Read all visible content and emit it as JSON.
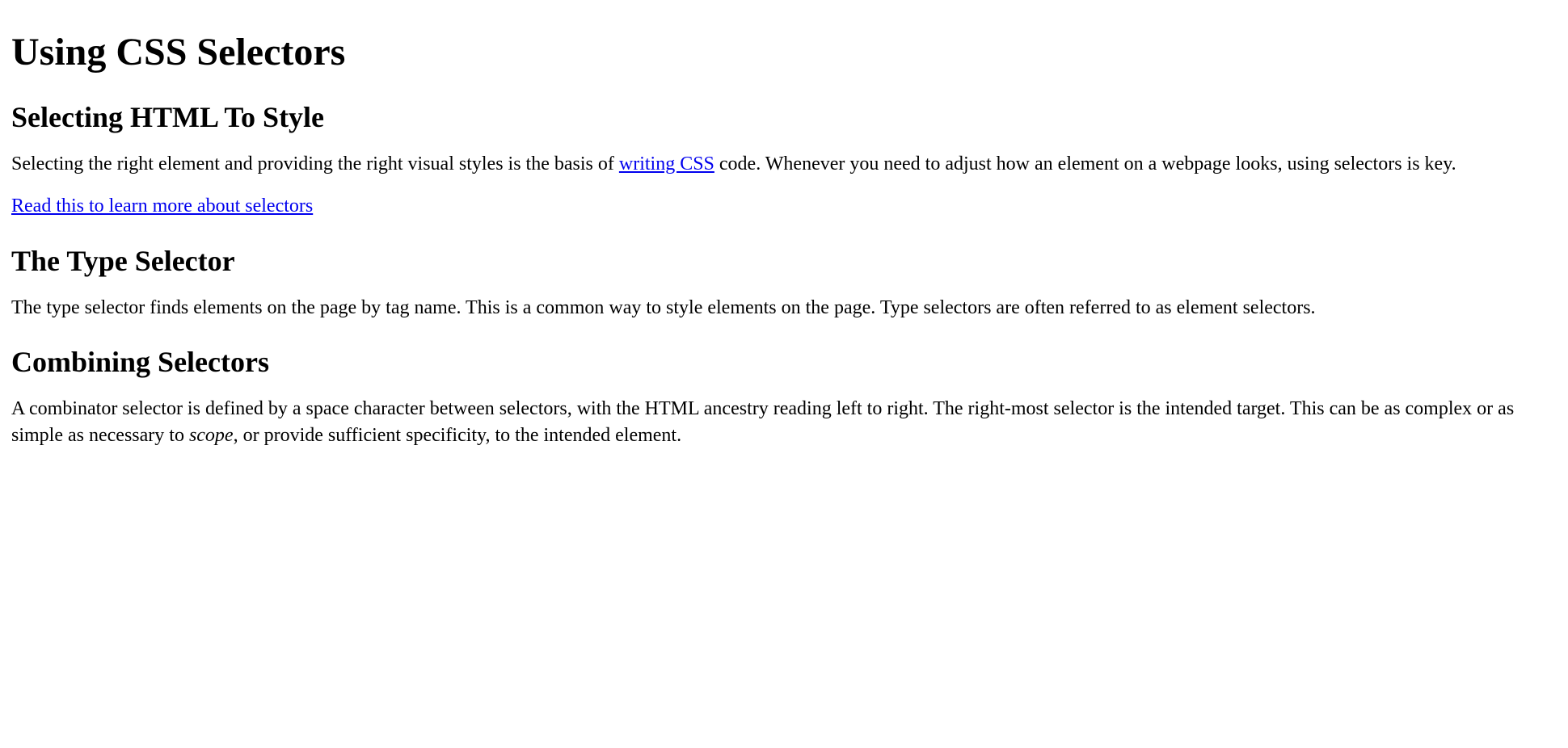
{
  "title": "Using CSS Selectors",
  "sections": {
    "intro": {
      "heading": "Selecting HTML To Style",
      "para_prefix": "Selecting the right element and providing the right visual styles is the basis of ",
      "link_text": "writing CSS",
      "para_suffix": " code. Whenever you need to adjust how an element on a webpage looks, using selectors is key.",
      "learn_more_link": "Read this to learn more about selectors"
    },
    "type_selector": {
      "heading": "The Type Selector",
      "para": "The type selector finds elements on the page by tag name. This is a common way to style elements on the page. Type selectors are often referred to as element selectors."
    },
    "combining": {
      "heading": "Combining Selectors",
      "para_prefix": "A combinator selector is defined by a space character between selectors, with the HTML ancestry reading left to right. The right-most selector is the intended target. This can be as complex or as simple as necessary to ",
      "em_text": "scope",
      "para_suffix": ", or provide sufficient specificity, to the intended element."
    }
  }
}
